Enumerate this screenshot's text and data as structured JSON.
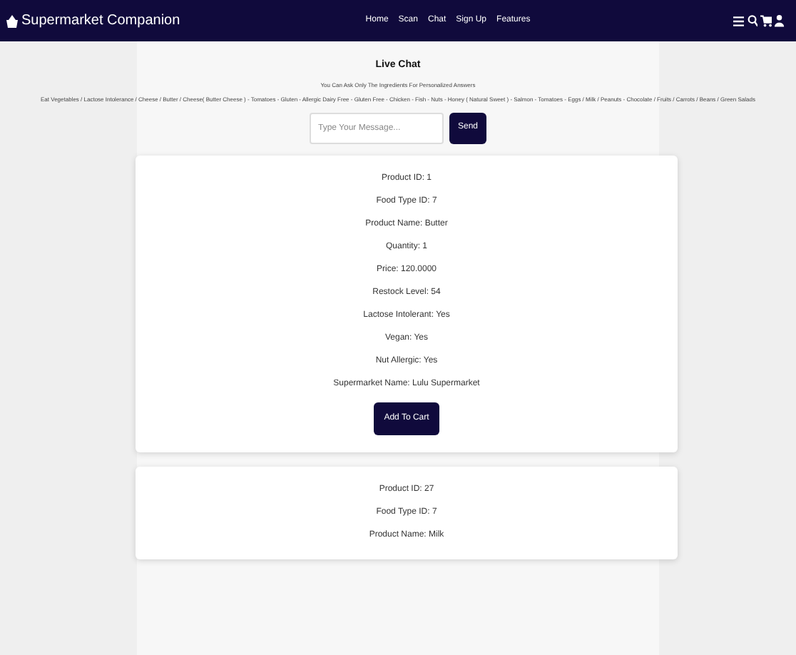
{
  "navbar": {
    "brand": "Supermarket Companion",
    "links": [
      "Home",
      "Scan",
      "Chat",
      "Sign Up",
      "Features"
    ]
  },
  "chat": {
    "title": "Live Chat",
    "subtitle": "You Can Ask Only The Ingredients For Personalized Answers",
    "ingredients": "Eat Vegetables / Lactose Intolerance / Cheese / Butter / Cheese( Butter Cheese ) - Tomatoes - Gluten - Allergic Dairy Free - Gluten Free - Chicken - Fish - Nuts - Honey ( Natural Sweet ) - Salmon - Tomatoes - Eggs / Milk / Peanuts - Chocolate / Fruits / Carrots / Beans / Green Salads",
    "placeholder": "Type Your Message...",
    "send": "Send"
  },
  "products": [
    {
      "lines": [
        "Product ID: 1",
        "Food Type ID: 7",
        "Product Name: Butter",
        "Quantity: 1",
        "Price: 120.0000",
        "Restock Level: 54",
        "Lactose Intolerant: Yes",
        "Vegan: Yes",
        "Nut Allergic: Yes",
        "Supermarket Name: Lulu Supermarket"
      ],
      "button": "Add To Cart"
    },
    {
      "lines": [
        "Product ID: 27",
        "Food Type ID: 7",
        "Product Name: Milk"
      ]
    }
  ]
}
